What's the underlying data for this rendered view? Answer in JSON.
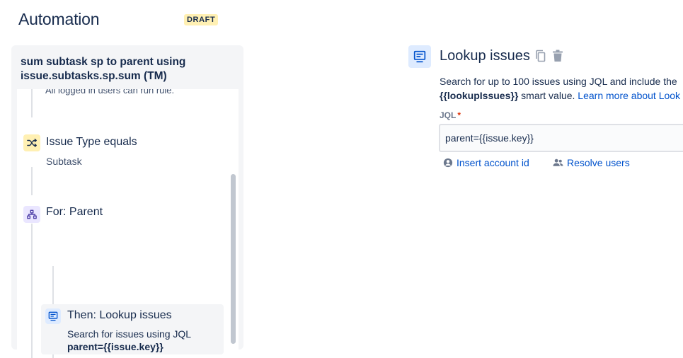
{
  "header": {
    "title": "Automation",
    "badge": "DRAFT"
  },
  "rule": {
    "name": "sum subtask sp to parent using issue.subtasks.sp.sum (TM)",
    "trigger_tail": "All logged in users can run rule.",
    "steps": [
      {
        "type": "condition",
        "icon": "shuffle-icon",
        "title": "Issue Type equals",
        "subtitle": "Subtask"
      },
      {
        "type": "branch",
        "icon": "hierarchy-icon",
        "title": "For: Parent"
      }
    ],
    "action": {
      "icon": "lookup-icon",
      "title": "Then: Lookup issues",
      "description": "Search for issues using JQL",
      "jql": "parent={{issue.key}}"
    }
  },
  "detail": {
    "title": "Lookup issues",
    "description_line1": "Search for up to 100 issues using JQL and include the",
    "smart_value": "{{lookupIssues}}",
    "description_line2_suffix": " smart value. ",
    "learn_more": "Learn more about Look",
    "jql_label": "JQL",
    "required_marker": "*",
    "jql_value": "parent={{issue.key}}",
    "insert_account_id": "Insert account id",
    "resolve_users": "Resolve users"
  },
  "colors": {
    "accent": "#0052cc",
    "draft_badge_bg": "#fff0b3",
    "condition_icon_bg": "#fff0b3",
    "branch_icon_bg": "#eae6ff",
    "action_icon_bg": "#deebff"
  }
}
